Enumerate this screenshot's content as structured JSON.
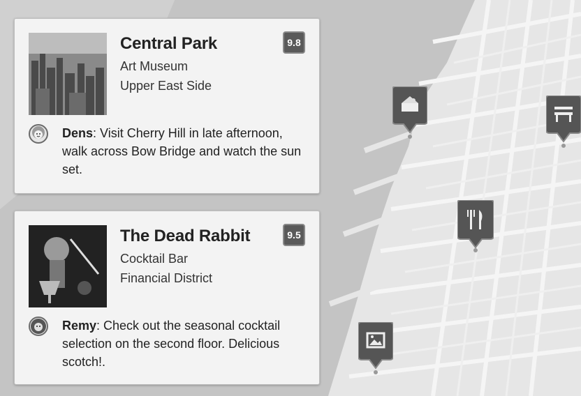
{
  "cards": [
    {
      "title": "Central Park",
      "category": "Art Museum",
      "neighborhood": "Upper East Side",
      "score": "9.8",
      "tip_author": "Dens",
      "tip_text": ": Visit Cherry Hill in late afternoon, walk across Bow Bridge and watch the sun set."
    },
    {
      "title": "The Dead Rabbit",
      "category": "Cocktail Bar",
      "neighborhood": "Financial District",
      "score": "9.5",
      "tip_author": "Remy",
      "tip_text": ": Check out the seasonal cocktail selection on the second floor. Delicious scotch!."
    }
  ],
  "map_pins": [
    {
      "icon": "museum-icon"
    },
    {
      "icon": "restaurant-icon"
    },
    {
      "icon": "park-bench-icon"
    },
    {
      "icon": "gallery-icon"
    }
  ]
}
